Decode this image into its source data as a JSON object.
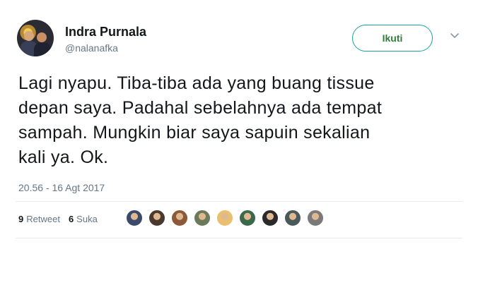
{
  "user": {
    "name": "Indra Purnala",
    "handle": "@nalanafka"
  },
  "follow_button": "Ikuti",
  "tweet": {
    "lines": [
      "Lagi nyapu. Tiba-tiba ada yang buang tissue",
      "depan saya. Padahal sebelahnya ada tempat",
      "sampah. Mungkin biar saya sapuin sekalian",
      "kali ya. Ok."
    ]
  },
  "timestamp": "20.56 - 16 Agt 2017",
  "stats": {
    "retweet_count": "9",
    "retweet_label": "Retweet",
    "like_count": "6",
    "like_label": "Suka"
  },
  "likers": [
    {
      "icon": "avatar-icon",
      "color": "#3b4a6b"
    },
    {
      "icon": "avatar-icon",
      "color": "#4a3a2e"
    },
    {
      "icon": "avatar-icon",
      "color": "#8a5a3a"
    },
    {
      "icon": "avatar-icon",
      "color": "#6b7a5a"
    },
    {
      "icon": "avatar-icon",
      "color": "#e8c070"
    },
    {
      "icon": "avatar-icon",
      "color": "#3a6a4a"
    },
    {
      "icon": "avatar-icon",
      "color": "#2a2a2a"
    },
    {
      "icon": "avatar-icon",
      "color": "#4a5a5a"
    },
    {
      "icon": "avatar-icon",
      "color": "#7a7a7a"
    }
  ],
  "colors": {
    "accent": "#1da1a0",
    "muted": "#657786",
    "text": "#14171a"
  }
}
